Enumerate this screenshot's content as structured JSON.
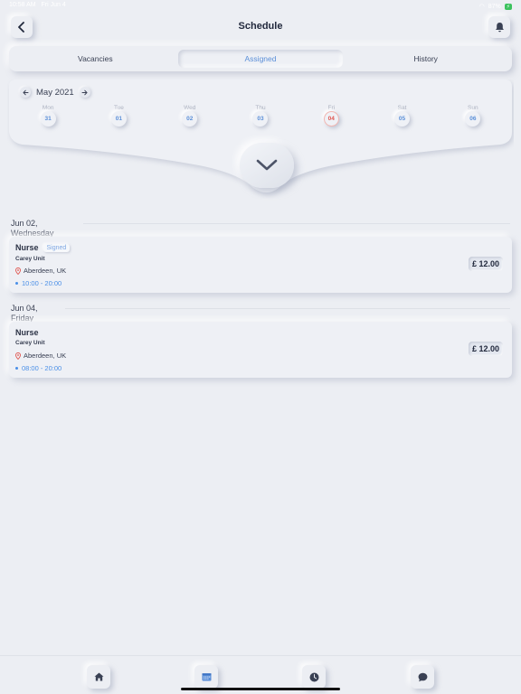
{
  "status_bar": {
    "time": "10:58 AM",
    "date": "Fri Jun 4",
    "battery": "87%"
  },
  "header": {
    "title": "Schedule"
  },
  "tabs": [
    {
      "label": "Vacancies",
      "active": false
    },
    {
      "label": "Assigned",
      "active": true
    },
    {
      "label": "History",
      "active": false
    }
  ],
  "calendar": {
    "month": "May 2021",
    "days": [
      {
        "name": "Mon",
        "num": "31",
        "today": false
      },
      {
        "name": "Tue",
        "num": "01",
        "today": false
      },
      {
        "name": "Wed",
        "num": "02",
        "today": false
      },
      {
        "name": "Thu",
        "num": "03",
        "today": false
      },
      {
        "name": "Fri",
        "num": "04",
        "today": true
      },
      {
        "name": "Sat",
        "num": "05",
        "today": false
      },
      {
        "name": "Sun",
        "num": "06",
        "today": false
      }
    ]
  },
  "shifts": [
    {
      "date_line1": "Jun 02,",
      "date_line2": "Wednesday",
      "role": "Nurse",
      "badge": "Signed",
      "unit": "Carey Unit",
      "location": "Aberdeen, UK",
      "time": "10:00 - 20:00",
      "price": "£ 12.00"
    },
    {
      "date_line1": "Jun 04,",
      "date_line2": "Friday",
      "role": "Nurse",
      "badge": "",
      "unit": "Carey Unit",
      "location": "Aberdeen, UK",
      "time": "08:00 - 20:00",
      "price": "£ 12.00"
    }
  ],
  "tabbar": {
    "items": [
      "home-icon",
      "calendar-icon",
      "clock-icon",
      "chat-icon"
    ],
    "accent": "#5b8fd8"
  }
}
